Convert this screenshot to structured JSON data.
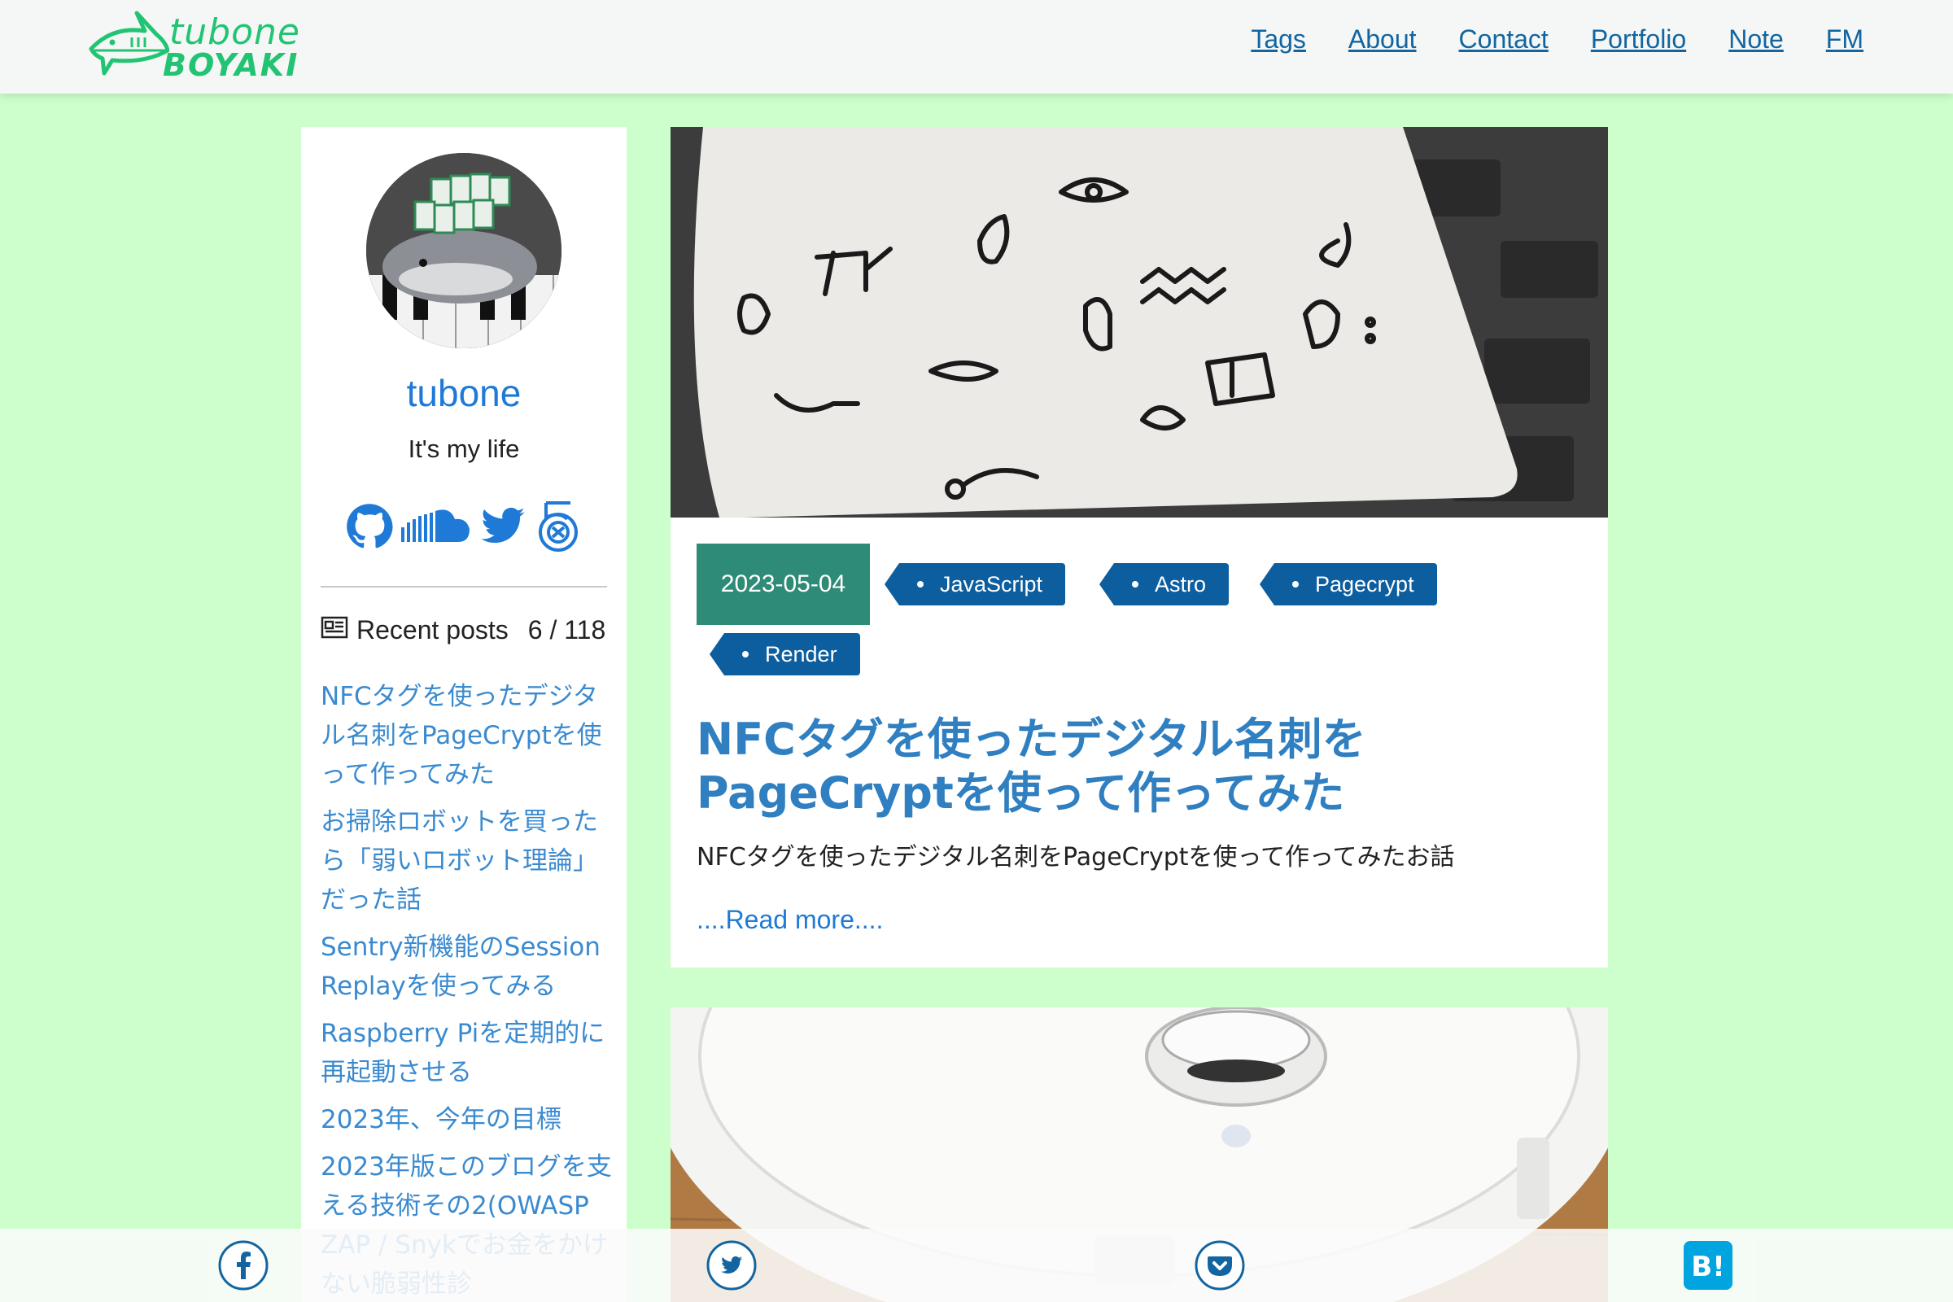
{
  "site": {
    "logo_line1": "tubone",
    "logo_line2": "BOYAKI"
  },
  "nav": [
    "Tags",
    "About",
    "Contact",
    "Portfolio",
    "Note",
    "FM"
  ],
  "sidebar": {
    "author_name": "tubone",
    "tagline": "It's my life",
    "social_icons": [
      "github-icon",
      "soundcloud-icon",
      "twitter-icon",
      "500px-icon"
    ],
    "recent_label": "Recent posts",
    "recent_count": "6 / 118",
    "recent_posts": [
      "NFCタグを使ったデジタル名刺をPageCryptを使って作ってみた",
      "お掃除ロボットを買ったら「弱いロボット理論」だった話",
      "Sentry新機能のSession Replayを使ってみる",
      "Raspberry Piを定期的に再起動させる",
      "2023年、今年の目標",
      "2023年版このブログを支える技術その2(OWASP ZAP / Snykでお金をかけない脆弱性診"
    ]
  },
  "post1": {
    "date": "2023-05-04",
    "tags": [
      "JavaScript",
      "Astro",
      "Pagecrypt",
      "Render"
    ],
    "title": "NFCタグを使ったデジタル名刺をPageCryptを使って作ってみた",
    "description": "NFCタグを使ったデジタル名刺をPageCryptを使って作ってみたお話",
    "read_more": "....Read more...."
  },
  "share": [
    "facebook-icon",
    "twitter-icon",
    "pocket-icon",
    "hatena-bookmark-icon"
  ],
  "colors": {
    "background": "#ccffcc",
    "nav_link": "#1265a0",
    "author_name": "#1e7ad6",
    "tag": "#0d5e9f",
    "date_badge": "#2e8b77",
    "post_title": "#2f7fc1",
    "logo": "#22c473"
  }
}
